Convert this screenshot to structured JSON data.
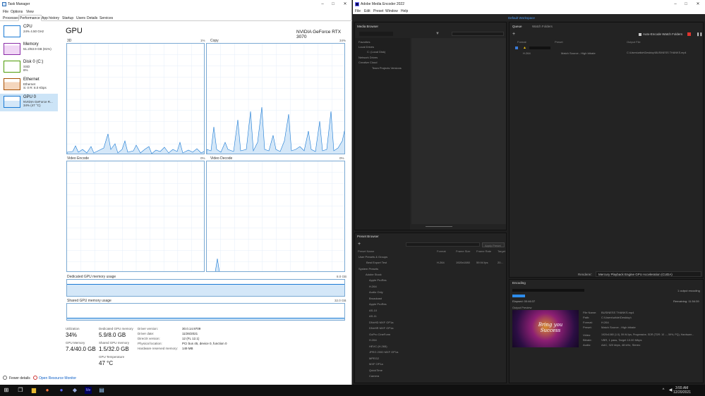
{
  "task_manager": {
    "title": "Task Manager",
    "menu": [
      "File",
      "Options",
      "View"
    ],
    "tabs": [
      "Processes",
      "Performance",
      "App history",
      "Startup",
      "Users",
      "Details",
      "Services"
    ],
    "active_tab": "Performance",
    "sidebar": [
      {
        "name": "CPU",
        "line2": "24%  4.50 GHz",
        "line3": ""
      },
      {
        "name": "Memory",
        "line2": "51.2/63.9 GB (81%)",
        "line3": ""
      },
      {
        "name": "Disk 0 (C:)",
        "line2": "SSD",
        "line3": "6%"
      },
      {
        "name": "Ethernet",
        "line2": "Ethernet",
        "line3": "S: 0  R: 8.0 Kbps"
      },
      {
        "name": "GPU 0",
        "line2": "NVIDIA GeForce R...",
        "line3": "34% (47 °C)"
      }
    ],
    "header": {
      "title": "GPU",
      "gpu_name": "NVIDIA GeForce RTX 3070"
    },
    "graphs": [
      {
        "label": "3D",
        "pct": "1%"
      },
      {
        "label": "Copy",
        "pct": "34%"
      },
      {
        "label": "Video Encode",
        "pct": "0%"
      },
      {
        "label": "Video Decode",
        "pct": "0%"
      }
    ],
    "dedicated_label": "Dedicated GPU memory usage",
    "dedicated_max": "8.0 GB",
    "shared_label": "Shared GPU memory usage",
    "shared_max": "32.0 GB",
    "stats": {
      "utilization_label": "Utilization",
      "utilization": "34%",
      "gpu_memory_label": "GPU Memory",
      "gpu_memory": "7.4/40.0 GB",
      "ded_label": "Dedicated GPU memory",
      "ded": "5.9/8.0 GB",
      "shared_label": "Shared GPU memory",
      "shared": "1.5/32.0 GB",
      "temp_label": "GPU Temperature",
      "temp": "47 °C"
    },
    "info": [
      {
        "k": "Driver version:",
        "v": "30.0.14.9709"
      },
      {
        "k": "Driver date:",
        "v": "11/26/2021"
      },
      {
        "k": "DirectX version:",
        "v": "12 (FL 12.1)"
      },
      {
        "k": "Physical location:",
        "v": "PCI bus 45, device 0, function 0"
      },
      {
        "k": "Hardware reserved memory:",
        "v": "149 MB"
      }
    ],
    "footer": {
      "fewer": "Fewer details",
      "monitor": "Open Resource Monitor"
    }
  },
  "media_encoder": {
    "title": "Adobe Media Encoder 2022",
    "menu": [
      "File",
      "Edit",
      "Preset",
      "Window",
      "Help"
    ],
    "workspace": "Default Workspace",
    "media_browser": "Media Browser",
    "tree": [
      "Favorites",
      "Local Drives",
      "C: (Local Disk)",
      "Network Drives",
      "Creative Cloud",
      "Team Projects Versions"
    ],
    "queue_tab": "Queue",
    "watch_tab": "Watch Folders",
    "auto_encode": "Auto-Encode Watch Folders",
    "queue_cols": [
      "Format",
      "Preset",
      "Output File"
    ],
    "queue_row": {
      "format": "H.264",
      "preset": "Match Source - High bitrate",
      "output": "C:\\Users\\wilde\\Desktop\\BUSINESS THANKS.mp4"
    },
    "renderer_label": "Renderer:",
    "renderer": "Mercury Playback Engine GPU Acceleration (CUDA)",
    "encoding_tab": "Encoding",
    "encoding_count": "1 output encoding",
    "elapsed": "Elapsed: 00:46:37",
    "remaining": "Remaining: 11:54:39",
    "output_preview": "Output Preview",
    "preview_text": "Bring you Success",
    "file_info": [
      {
        "k": "File Name:",
        "v": "BUSINESS THANKS.mp4"
      },
      {
        "k": "Path:",
        "v": "C:\\Users\\wilde\\Desktop\\"
      },
      {
        "k": "Format:",
        "v": "H.264"
      },
      {
        "k": "Preset:",
        "v": "Match Source - High bitrate"
      },
      {
        "k": "Video:",
        "v": "1920x1080 (1.0), 59.94 fps, Progressive, SDR (TDR: 10 ..., 59%, PQ), Hardware..."
      },
      {
        "k": "Bitrate:",
        "v": "VBR, 1 pass, Target 10.00 Mbps"
      },
      {
        "k": "Audio:",
        "v": "AAC, 320 kbps, 48 kHz, Stereo"
      }
    ],
    "preset_browser": "Preset Browser",
    "apply_preset": "Apply Preset",
    "preset_cols": [
      "Preset Name",
      "Format",
      "Frame Size",
      "Frame Rate",
      "Target"
    ],
    "user_presets": "User Presets & Groups",
    "user_preset_row": {
      "name": "Best Export Test",
      "format": "H.264",
      "size": "1920x1080",
      "rate": "59.94 fps",
      "target": "20..."
    },
    "system_presets": "System Presets",
    "preset_tree": [
      "Adobe Stock",
      "Apple ProRes",
      "H.264",
      "Audio Only",
      "Broadcast",
      "Apple ProRes",
      "AS-10",
      "AS-11",
      "DNxHD MXF OP1a",
      "DNxHR MXF OP1a",
      "GoPro CineForm",
      "H.264",
      "HEVC (H.265)",
      "JPEG 2000 MXF OP1a",
      "MPEG2",
      "MXF OP1a",
      "QuickTime",
      "Camera"
    ]
  },
  "taskbar": {
    "time": "3:55 AM",
    "date": "12/20/2021"
  }
}
